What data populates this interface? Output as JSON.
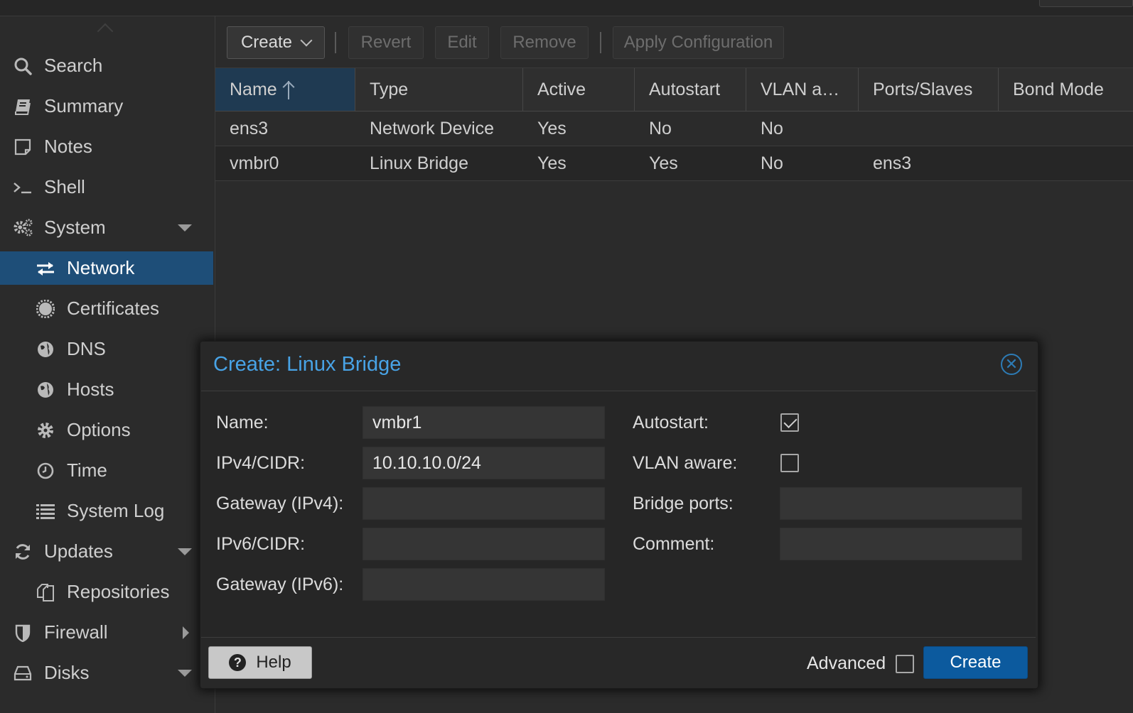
{
  "sidebar": {
    "items": [
      {
        "label": "Search",
        "icon": "search-icon"
      },
      {
        "label": "Summary",
        "icon": "book-icon"
      },
      {
        "label": "Notes",
        "icon": "note-icon"
      },
      {
        "label": "Shell",
        "icon": "terminal-icon"
      },
      {
        "label": "System",
        "icon": "gears-icon",
        "expanded": true
      },
      {
        "label": "Network",
        "icon": "exchange-icon",
        "active": true
      },
      {
        "label": "Certificates",
        "icon": "certificate-icon"
      },
      {
        "label": "DNS",
        "icon": "globe-icon"
      },
      {
        "label": "Hosts",
        "icon": "globe-icon"
      },
      {
        "label": "Options",
        "icon": "gear-icon"
      },
      {
        "label": "Time",
        "icon": "clock-icon"
      },
      {
        "label": "System Log",
        "icon": "list-icon"
      },
      {
        "label": "Updates",
        "icon": "refresh-icon",
        "expanded": true
      },
      {
        "label": "Repositories",
        "icon": "files-icon"
      },
      {
        "label": "Firewall",
        "icon": "shield-icon",
        "expanded": false
      },
      {
        "label": "Disks",
        "icon": "hdd-icon",
        "expanded": true
      }
    ]
  },
  "toolbar": {
    "create_label": "Create",
    "revert_label": "Revert",
    "edit_label": "Edit",
    "remove_label": "Remove",
    "apply_label": "Apply Configuration"
  },
  "grid": {
    "columns": [
      "Name",
      "Type",
      "Active",
      "Autostart",
      "VLAN a…",
      "Ports/Slaves",
      "Bond Mode"
    ],
    "sorted_column": "Name",
    "rows": [
      {
        "name": "ens3",
        "type": "Network Device",
        "active": "Yes",
        "autostart": "No",
        "vlan": "No",
        "ports": ""
      },
      {
        "name": "vmbr0",
        "type": "Linux Bridge",
        "active": "Yes",
        "autostart": "Yes",
        "vlan": "No",
        "ports": "ens3"
      }
    ]
  },
  "dialog": {
    "title": "Create: Linux Bridge",
    "fields": {
      "name_label": "Name:",
      "name_value": "vmbr1",
      "ipv4_label": "IPv4/CIDR:",
      "ipv4_value": "10.10.10.0/24",
      "gw4_label": "Gateway (IPv4):",
      "gw4_value": "",
      "ipv6_label": "IPv6/CIDR:",
      "ipv6_value": "",
      "gw6_label": "Gateway (IPv6):",
      "gw6_value": "",
      "autostart_label": "Autostart:",
      "autostart_checked": true,
      "vlan_label": "VLAN aware:",
      "vlan_checked": false,
      "ports_label": "Bridge ports:",
      "ports_value": "",
      "comment_label": "Comment:",
      "comment_value": ""
    },
    "help_label": "Help",
    "advanced_label": "Advanced",
    "advanced_checked": false,
    "create_label": "Create"
  },
  "colors": {
    "accent": "#1e4e78",
    "title": "#48a3e6",
    "primary_button": "#0c5a9e"
  }
}
